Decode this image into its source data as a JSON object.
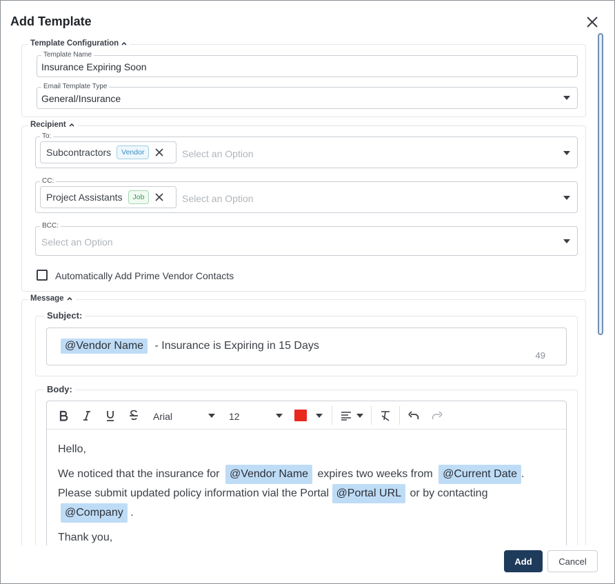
{
  "dialog": {
    "title": "Add Template",
    "add_label": "Add",
    "cancel_label": "Cancel"
  },
  "template_config": {
    "legend": "Template Configuration",
    "name_label": "Template Name",
    "name_value": "Insurance Expiring Soon",
    "type_label": "Email Template Type",
    "type_value": "General/Insurance"
  },
  "recipient": {
    "legend": "Recipient",
    "to_label": "To:",
    "to_chip": {
      "label": "Subcontractors",
      "tag": "Vendor",
      "tag_color": "#3b8cc4",
      "tag_bg": "#eef7fc"
    },
    "cc_label": "CC:",
    "cc_chip": {
      "label": "Project Assistants",
      "tag": "Job",
      "tag_color": "#3f9a52",
      "tag_bg": "#f0faf2"
    },
    "bcc_label": "BCC:",
    "placeholder": "Select an Option",
    "auto_add_label": "Automatically Add Prime Vendor Contacts",
    "auto_add_checked": false
  },
  "message": {
    "legend": "Message",
    "subject_label": "Subject:",
    "subject_mention": "@Vendor Name",
    "subject_text": "- Insurance is Expiring in 15 Days",
    "subject_count": "49",
    "body_label": "Body:",
    "toolbar": {
      "font": "Arial",
      "size": "12",
      "text_color": "#e8281c",
      "icons": [
        "bold-icon",
        "italic-icon",
        "underline-icon",
        "strikethrough-icon",
        "font-dropdown",
        "size-dropdown",
        "text-color-icon",
        "align-icon",
        "clear-format-icon",
        "undo-icon",
        "redo-icon"
      ]
    },
    "body": {
      "greeting": "Hello,",
      "line1_a": "We noticed that the insurance for",
      "mention_vendor": "@Vendor Name",
      "line1_b": "expires two weeks from",
      "mention_date": "@Current Date",
      "line1_c": ".",
      "line2_a": "Please submit updated policy information vial the Portal",
      "mention_portal": "@Portal URL",
      "line2_b": "or by contacting",
      "mention_company": "@Company",
      "line2_c": ".",
      "closing": "Thank you,"
    }
  }
}
